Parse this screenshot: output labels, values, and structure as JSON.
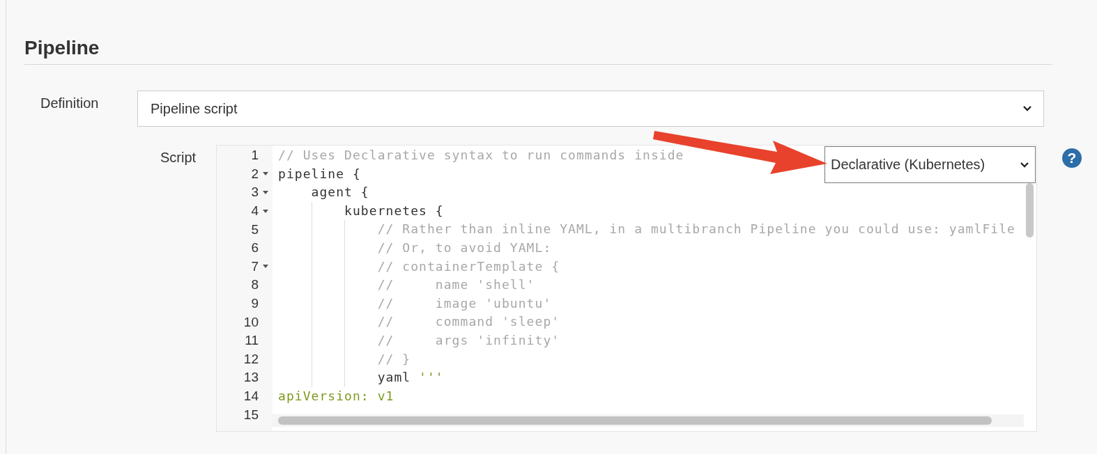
{
  "section": {
    "title": "Pipeline"
  },
  "definition": {
    "label": "Definition",
    "value": "Pipeline script"
  },
  "script": {
    "label": "Script",
    "template": "Declarative (Kubernetes)",
    "help": "?",
    "lines": [
      {
        "number": "1",
        "foldable": false,
        "tokens": [
          {
            "kind": "comment",
            "text": "// Uses Declarative syntax to run commands inside"
          }
        ]
      },
      {
        "number": "2",
        "foldable": true,
        "tokens": [
          {
            "kind": "code",
            "text": "pipeline {"
          }
        ]
      },
      {
        "number": "3",
        "foldable": true,
        "tokens": [
          {
            "kind": "code",
            "text": "    agent {"
          }
        ]
      },
      {
        "number": "4",
        "foldable": true,
        "tokens": [
          {
            "kind": "code",
            "text": "        kubernetes {"
          }
        ]
      },
      {
        "number": "5",
        "foldable": false,
        "tokens": [
          {
            "kind": "comment",
            "text": "            // Rather than inline YAML, in a multibranch Pipeline you could use: yamlFile"
          }
        ]
      },
      {
        "number": "6",
        "foldable": false,
        "tokens": [
          {
            "kind": "comment",
            "text": "            // Or, to avoid YAML:"
          }
        ]
      },
      {
        "number": "7",
        "foldable": true,
        "tokens": [
          {
            "kind": "comment",
            "text": "            // containerTemplate {"
          }
        ]
      },
      {
        "number": "8",
        "foldable": false,
        "tokens": [
          {
            "kind": "comment",
            "text": "            //     name 'shell'"
          }
        ]
      },
      {
        "number": "9",
        "foldable": false,
        "tokens": [
          {
            "kind": "comment",
            "text": "            //     image 'ubuntu'"
          }
        ]
      },
      {
        "number": "10",
        "foldable": false,
        "tokens": [
          {
            "kind": "comment",
            "text": "            //     command 'sleep'"
          }
        ]
      },
      {
        "number": "11",
        "foldable": false,
        "tokens": [
          {
            "kind": "comment",
            "text": "            //     args 'infinity'"
          }
        ]
      },
      {
        "number": "12",
        "foldable": false,
        "tokens": [
          {
            "kind": "comment",
            "text": "            // }"
          }
        ]
      },
      {
        "number": "13",
        "foldable": false,
        "tokens": [
          {
            "kind": "code",
            "text": "            yaml "
          },
          {
            "kind": "string",
            "text": "'''"
          }
        ]
      },
      {
        "number": "14",
        "foldable": false,
        "tokens": [
          {
            "kind": "string",
            "text": "apiVersion: v1"
          }
        ]
      },
      {
        "number": "15",
        "foldable": false
      }
    ]
  }
}
